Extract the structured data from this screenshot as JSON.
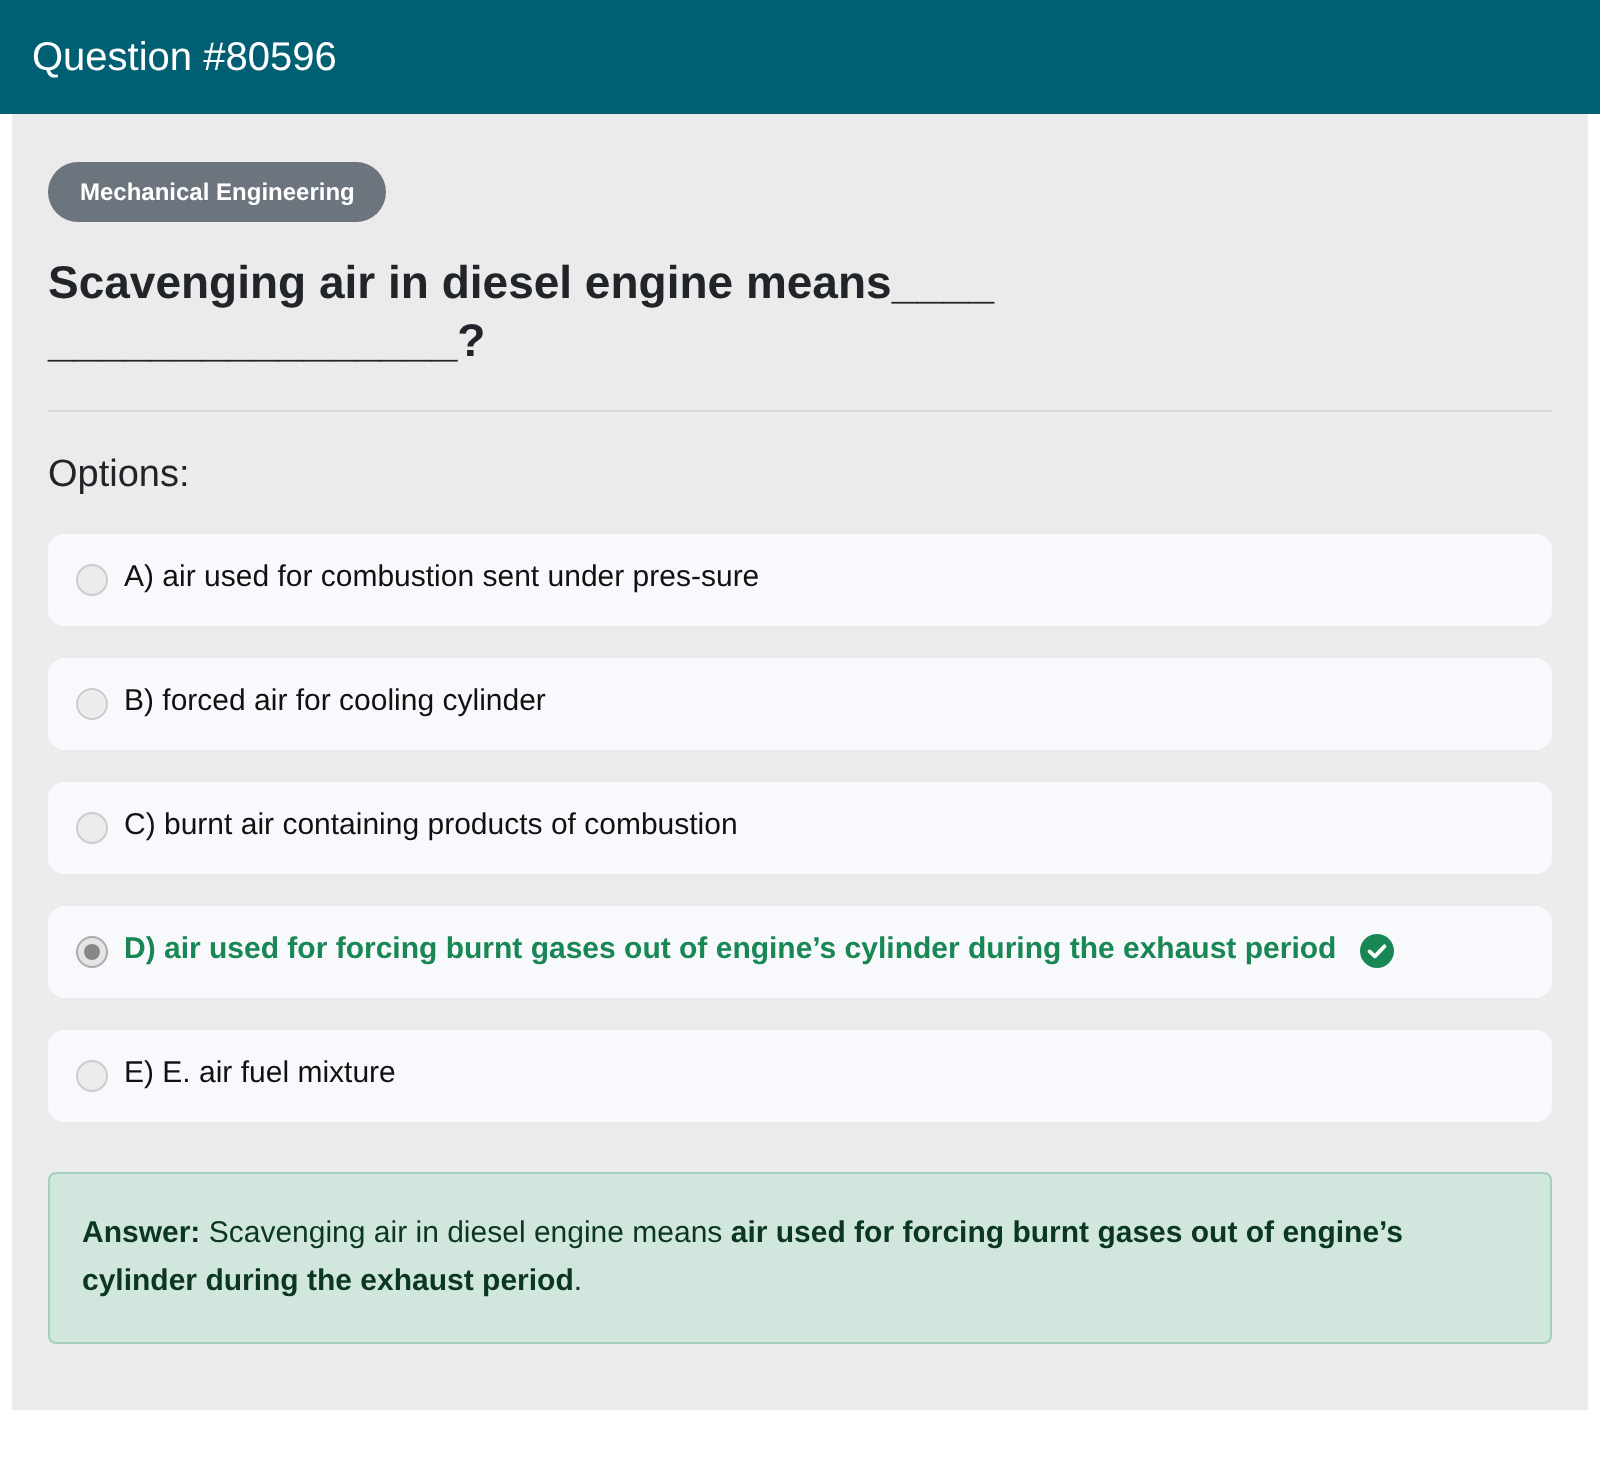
{
  "header": {
    "title": "Question #80596"
  },
  "category": "Mechanical Engineering",
  "question": "Scavenging air in diesel engine means____________________?",
  "options_label": "Options:",
  "options": [
    {
      "text": "A) air used for combustion sent under pres-sure",
      "selected": false,
      "correct": false
    },
    {
      "text": "B) forced air for cooling cylinder",
      "selected": false,
      "correct": false
    },
    {
      "text": "C) burnt air containing products of combustion",
      "selected": false,
      "correct": false
    },
    {
      "text": "D) air used for forcing burnt gases out of engine’s cylinder during the exhaust period",
      "selected": true,
      "correct": true
    },
    {
      "text": "E) E. air fuel mixture",
      "selected": false,
      "correct": false
    }
  ],
  "answer": "**Answer:** Scavenging air in diesel engine means **air used for forcing burnt gases out of engine’s cylinder during the exhaust period**."
}
